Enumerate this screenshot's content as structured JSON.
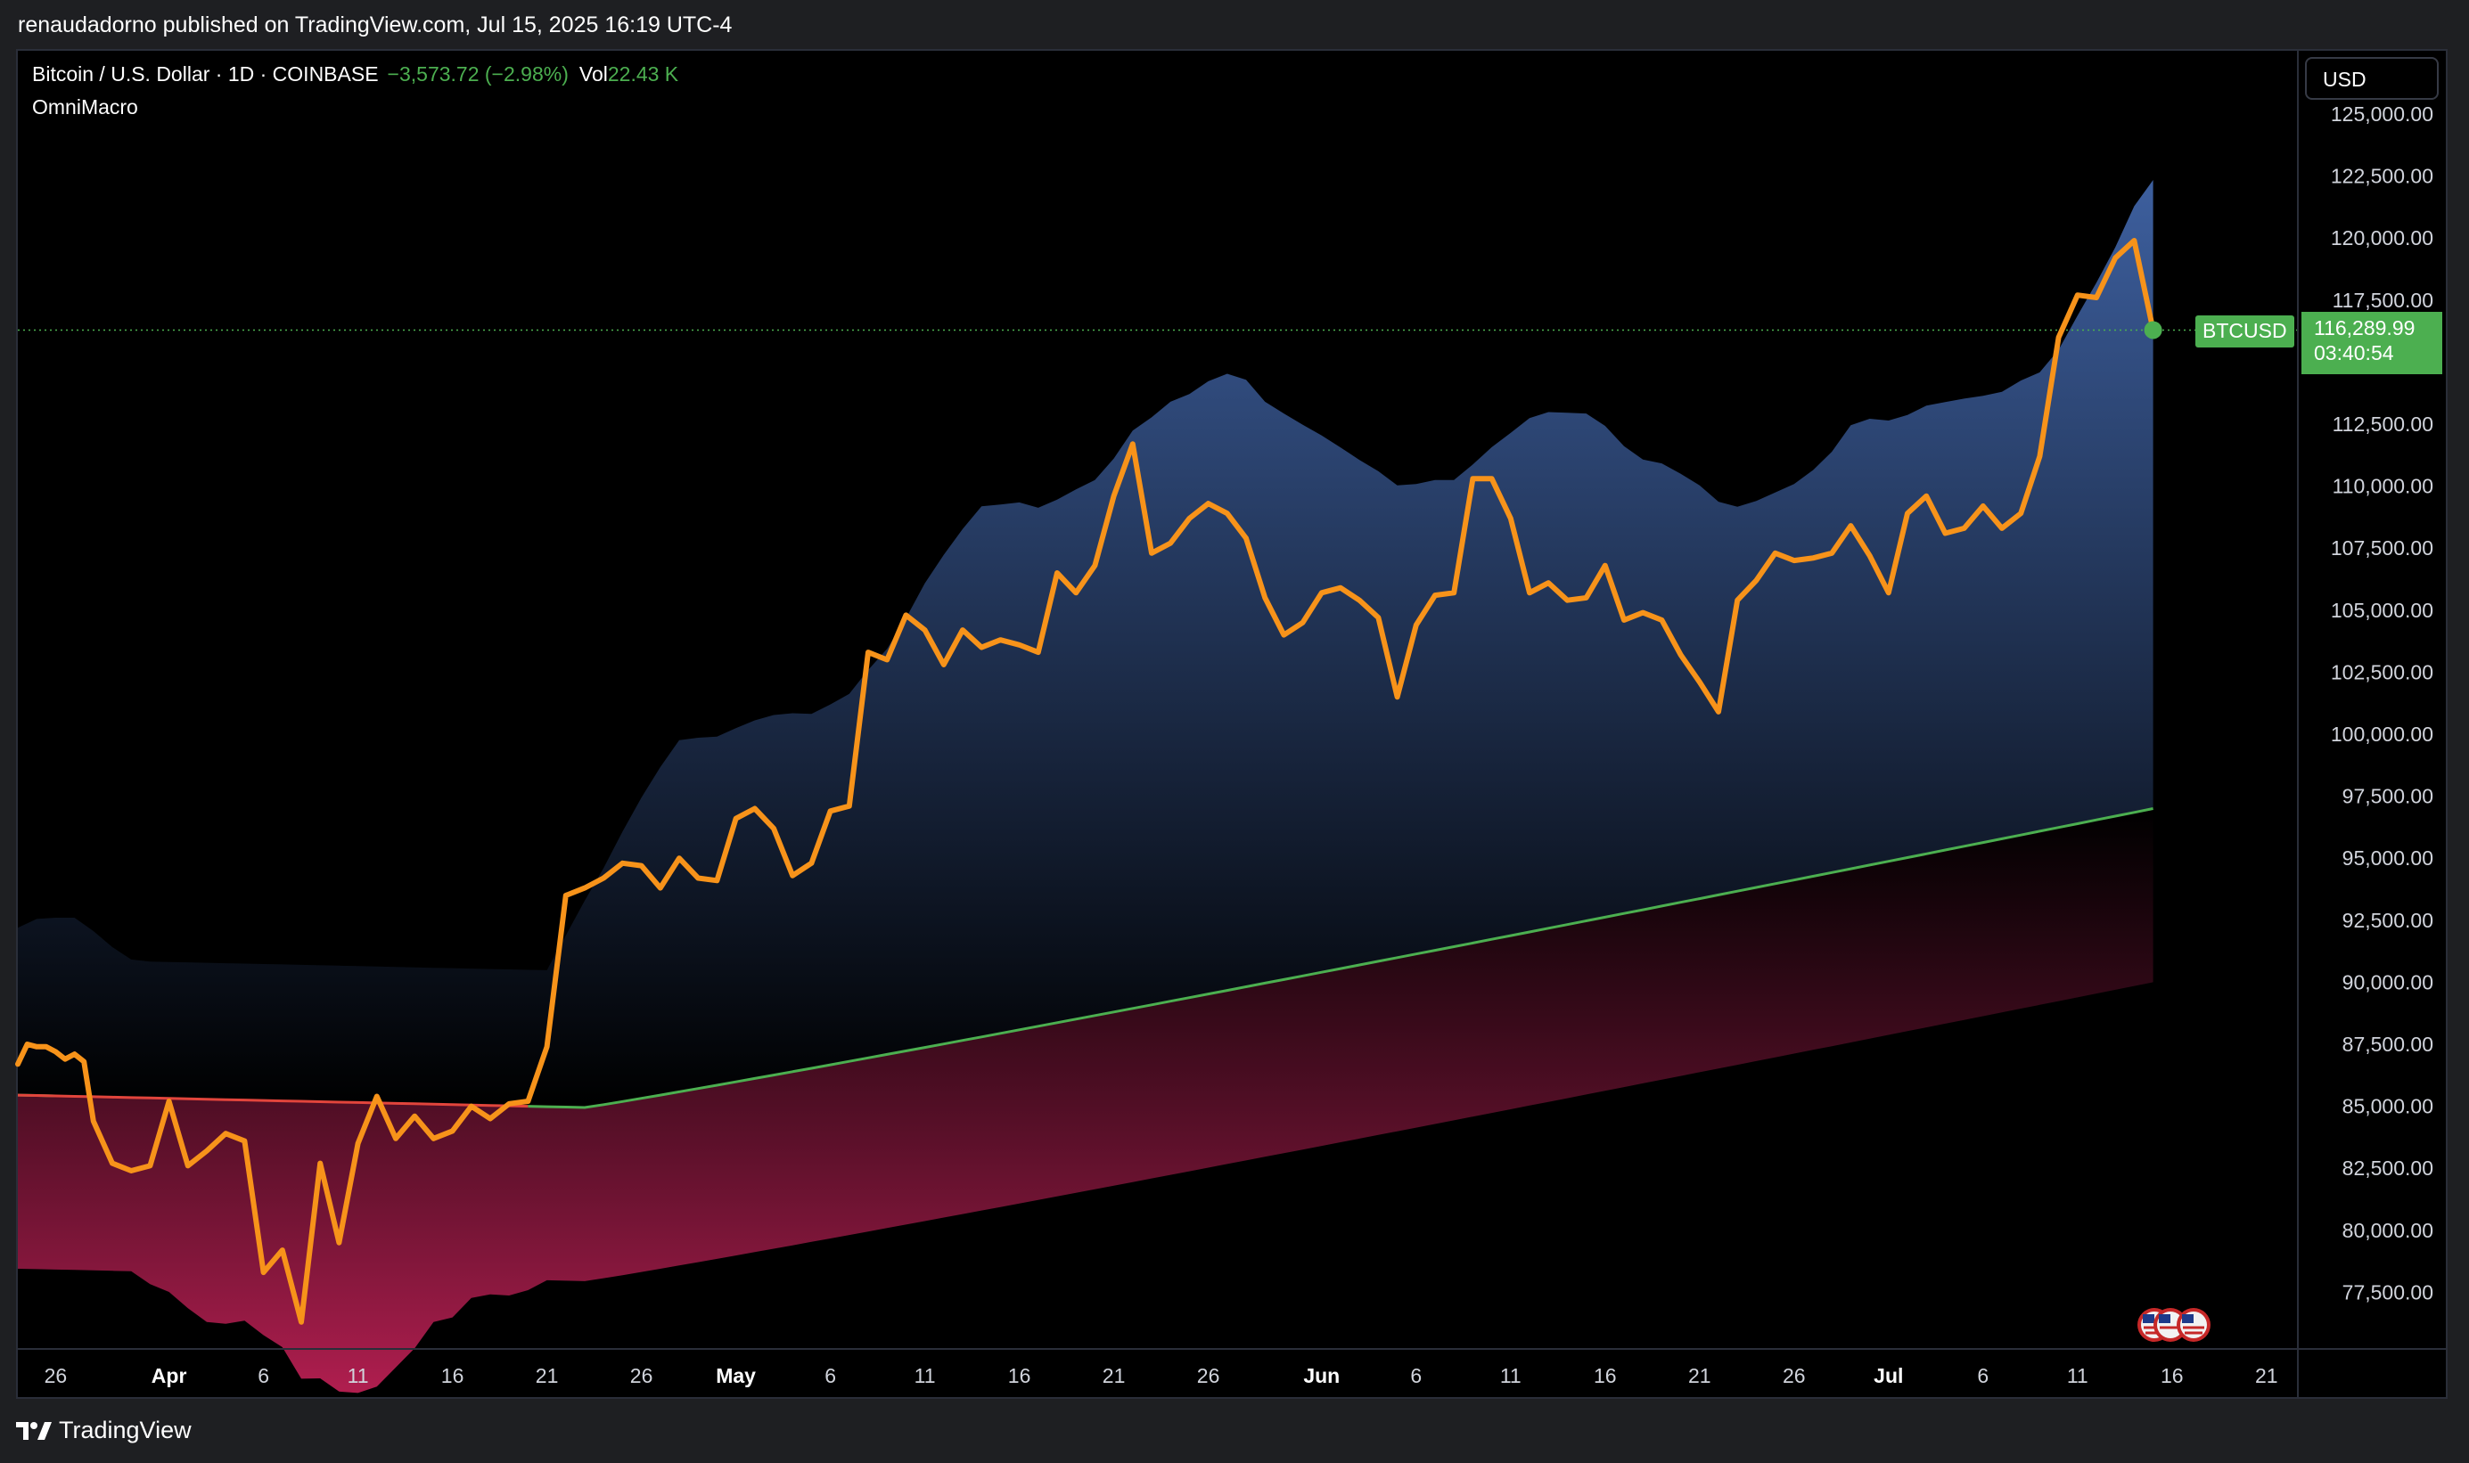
{
  "publish_line": "renaudadorno published on TradingView.com, Jul 15, 2025 16:19 UTC-4",
  "legend": {
    "title": "Bitcoin / U.S. Dollar · 1D · COINBASE",
    "change": "−3,573.72 (−2.98%)",
    "vol_label": "Vol",
    "vol_value": "22.43 K",
    "indicator": "OmniMacro"
  },
  "currency_button": "USD",
  "last_price": {
    "symbol": "BTCUSD",
    "price": "116,289.99",
    "countdown": "03:40:54"
  },
  "brand": "TradingView",
  "colors": {
    "price_line": "#f7931a",
    "ma_up": "#4caf50",
    "ma_down": "#e2453c",
    "upper_band": "#3d5f9e",
    "lower_band": "#8e1a43",
    "last_price": "#4caf50"
  },
  "chart_data": {
    "type": "line",
    "x_ticks": [
      {
        "i": 2,
        "label": "26",
        "bold": false
      },
      {
        "i": 8,
        "label": "Apr",
        "bold": true
      },
      {
        "i": 13,
        "label": "6",
        "bold": false
      },
      {
        "i": 18,
        "label": "11",
        "bold": false
      },
      {
        "i": 23,
        "label": "16",
        "bold": false
      },
      {
        "i": 28,
        "label": "21",
        "bold": false
      },
      {
        "i": 33,
        "label": "26",
        "bold": false
      },
      {
        "i": 38,
        "label": "May",
        "bold": true
      },
      {
        "i": 43,
        "label": "6",
        "bold": false
      },
      {
        "i": 48,
        "label": "11",
        "bold": false
      },
      {
        "i": 53,
        "label": "16",
        "bold": false
      },
      {
        "i": 58,
        "label": "21",
        "bold": false
      },
      {
        "i": 63,
        "label": "26",
        "bold": false
      },
      {
        "i": 69,
        "label": "Jun",
        "bold": true
      },
      {
        "i": 74,
        "label": "6",
        "bold": false
      },
      {
        "i": 79,
        "label": "11",
        "bold": false
      },
      {
        "i": 84,
        "label": "16",
        "bold": false
      },
      {
        "i": 89,
        "label": "21",
        "bold": false
      },
      {
        "i": 94,
        "label": "26",
        "bold": false
      },
      {
        "i": 99,
        "label": "Jul",
        "bold": true
      },
      {
        "i": 104,
        "label": "6",
        "bold": false
      },
      {
        "i": 109,
        "label": "11",
        "bold": false
      },
      {
        "i": 114,
        "label": "16",
        "bold": false
      },
      {
        "i": 119,
        "label": "21",
        "bold": false
      }
    ],
    "y_ticks": [
      "125,000.00",
      "122,500.00",
      "120,000.00",
      "117,500.00",
      "112,500.00",
      "110,000.00",
      "107,500.00",
      "105,000.00",
      "102,500.00",
      "100,000.00",
      "97,500.00",
      "95,000.00",
      "92,500.00",
      "90,000.00",
      "87,500.00",
      "85,000.00",
      "82,500.00",
      "80,000.00",
      "77,500.00"
    ],
    "ylim": [
      75500,
      126000
    ],
    "series": [
      {
        "name": "BTCUSD",
        "points": [
          [
            0,
            86700
          ],
          [
            0.5,
            87500
          ],
          [
            1,
            87400
          ],
          [
            1.5,
            87400
          ],
          [
            2,
            87200
          ],
          [
            2.5,
            86900
          ],
          [
            3,
            87100
          ],
          [
            3.5,
            86800
          ],
          [
            4,
            84400
          ],
          [
            5,
            82700
          ],
          [
            6,
            82400
          ],
          [
            7,
            82600
          ],
          [
            8,
            85200
          ],
          [
            9,
            82600
          ],
          [
            10,
            83200
          ],
          [
            11,
            83900
          ],
          [
            12,
            83600
          ],
          [
            13,
            78300
          ],
          [
            14,
            79200
          ],
          [
            15,
            76300
          ],
          [
            16,
            82700
          ],
          [
            17,
            79500
          ],
          [
            18,
            83500
          ],
          [
            19,
            85400
          ],
          [
            20,
            83700
          ],
          [
            21,
            84600
          ],
          [
            22,
            83700
          ],
          [
            23,
            84000
          ],
          [
            24,
            85000
          ],
          [
            25,
            84500
          ],
          [
            26,
            85100
          ],
          [
            27,
            85200
          ],
          [
            28,
            87400
          ],
          [
            29,
            93500
          ],
          [
            30,
            93800
          ],
          [
            31,
            94200
          ],
          [
            32,
            94800
          ],
          [
            33,
            94700
          ],
          [
            34,
            93800
          ],
          [
            35,
            95000
          ],
          [
            36,
            94200
          ],
          [
            37,
            94100
          ],
          [
            38,
            96600
          ],
          [
            39,
            97000
          ],
          [
            40,
            96200
          ],
          [
            41,
            94300
          ],
          [
            42,
            94800
          ],
          [
            43,
            96900
          ],
          [
            44,
            97100
          ],
          [
            45,
            103300
          ],
          [
            46,
            103000
          ],
          [
            47,
            104800
          ],
          [
            48,
            104200
          ],
          [
            49,
            102800
          ],
          [
            50,
            104200
          ],
          [
            51,
            103500
          ],
          [
            52,
            103800
          ],
          [
            53,
            103600
          ],
          [
            54,
            103300
          ],
          [
            55,
            106500
          ],
          [
            56,
            105700
          ],
          [
            57,
            106800
          ],
          [
            58,
            109600
          ],
          [
            59,
            111700
          ],
          [
            60,
            107300
          ],
          [
            61,
            107700
          ],
          [
            62,
            108700
          ],
          [
            63,
            109300
          ],
          [
            64,
            108900
          ],
          [
            65,
            107900
          ],
          [
            66,
            105500
          ],
          [
            67,
            104000
          ],
          [
            68,
            104500
          ],
          [
            69,
            105700
          ],
          [
            70,
            105900
          ],
          [
            71,
            105400
          ],
          [
            72,
            104700
          ],
          [
            73,
            101500
          ],
          [
            74,
            104400
          ],
          [
            75,
            105600
          ],
          [
            76,
            105700
          ],
          [
            77,
            110300
          ],
          [
            78,
            110300
          ],
          [
            79,
            108700
          ],
          [
            80,
            105700
          ],
          [
            81,
            106100
          ],
          [
            82,
            105400
          ],
          [
            83,
            105500
          ],
          [
            84,
            106800
          ],
          [
            85,
            104600
          ],
          [
            86,
            104900
          ],
          [
            87,
            104600
          ],
          [
            88,
            103200
          ],
          [
            89,
            102100
          ],
          [
            90,
            100900
          ],
          [
            91,
            105400
          ],
          [
            92,
            106200
          ],
          [
            93,
            107300
          ],
          [
            94,
            107000
          ],
          [
            95,
            107100
          ],
          [
            96,
            107300
          ],
          [
            97,
            108400
          ],
          [
            98,
            107200
          ],
          [
            99,
            105700
          ],
          [
            100,
            108900
          ],
          [
            101,
            109600
          ],
          [
            102,
            108100
          ],
          [
            103,
            108300
          ],
          [
            104,
            109200
          ],
          [
            105,
            108300
          ],
          [
            106,
            108900
          ],
          [
            107,
            111200
          ],
          [
            108,
            116000
          ],
          [
            109,
            117700
          ],
          [
            110,
            117600
          ],
          [
            111,
            119200
          ],
          [
            112,
            119900
          ],
          [
            113,
            116290
          ]
        ]
      }
    ]
  }
}
